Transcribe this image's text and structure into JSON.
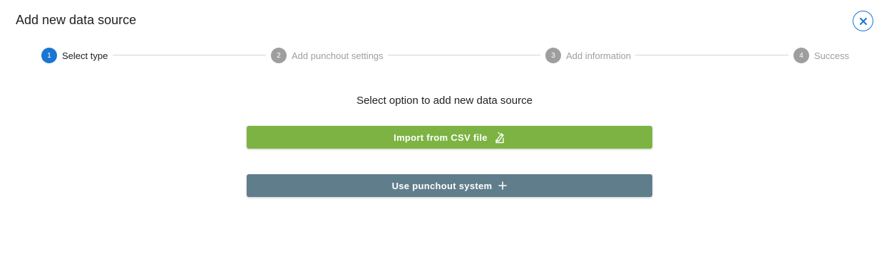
{
  "dialog": {
    "title": "Add new data source",
    "close_icon": "close-icon"
  },
  "stepper": {
    "steps": [
      {
        "number": "1",
        "label": "Select type",
        "state": "active"
      },
      {
        "number": "2",
        "label": "Add punchout settings",
        "state": "inactive"
      },
      {
        "number": "3",
        "label": "Add information",
        "state": "inactive"
      },
      {
        "number": "4",
        "label": "Success",
        "state": "inactive"
      }
    ]
  },
  "main": {
    "prompt": "Select option to add new data source",
    "import_csv": {
      "label": "Import from CSV file",
      "icon": "file-import-icon",
      "color": "#7cb342"
    },
    "punchout": {
      "label": "Use punchout system",
      "icon": "plus-icon",
      "color": "#607d8b"
    }
  },
  "colors": {
    "accent": "#1976d2",
    "inactive_step": "#9e9e9e"
  }
}
